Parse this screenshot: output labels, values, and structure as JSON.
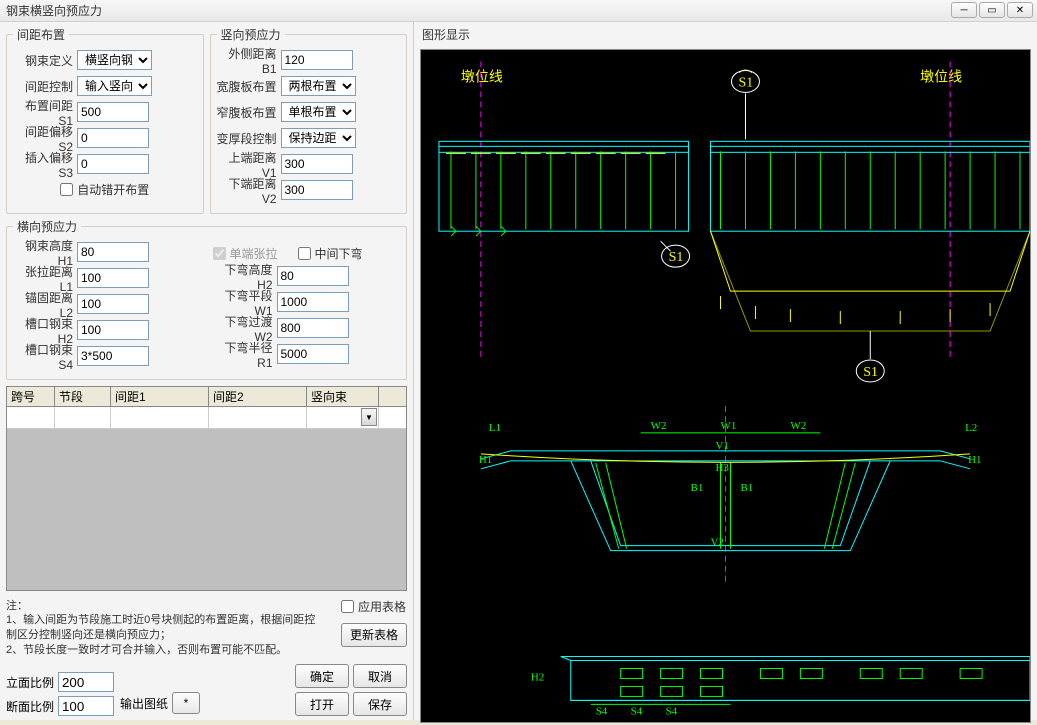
{
  "window": {
    "title": "钢束横竖向预应力"
  },
  "groups": {
    "spacing": "间距布置",
    "vertical": "竖向预应力",
    "lateral": "横向预应力"
  },
  "spacing": {
    "def_label": "钢束定义",
    "def_value": "横竖向钢",
    "ctrl_label": "间距控制",
    "ctrl_value": "输入竖向",
    "s1_label": "布置间距S1",
    "s1_value": "500",
    "s2_label": "间距偏移S2",
    "s2_value": "0",
    "s3_label": "插入偏移S3",
    "s3_value": "0",
    "auto_label": "自动错开布置"
  },
  "vertical": {
    "b1_label": "外侧距离B1",
    "b1_value": "120",
    "wide_label": "宽腹板布置",
    "wide_value": "两根布置",
    "narrow_label": "窄腹板布置",
    "narrow_value": "单根布置",
    "thick_label": "变厚段控制",
    "thick_value": "保持边距",
    "v1_label": "上端距离V1",
    "v1_value": "300",
    "v2_label": "下端距离V2",
    "v2_value": "300"
  },
  "lateral": {
    "h1_label": "钢束高度H1",
    "h1_value": "80",
    "l1_label": "张拉距离L1",
    "l1_value": "100",
    "l2_label": "锚固距离L2",
    "l2_value": "100",
    "h2_label": "槽口钢束H2",
    "h2_value": "100",
    "s4_label": "槽口钢束S4",
    "s4_value": "3*500",
    "single_label": "单端张拉",
    "mid_label": "中间下弯",
    "bh2_label": "下弯高度H2",
    "bh2_value": "80",
    "bw1_label": "下弯平段W1",
    "bw1_value": "1000",
    "bw2_label": "下弯过渡W2",
    "bw2_value": "800",
    "br1_label": "下弯半径R1",
    "br1_value": "5000"
  },
  "table": {
    "col1": "跨号",
    "col2": "节段",
    "col3": "间距1",
    "col4": "间距2",
    "col5": "竖向束"
  },
  "notes": {
    "header": "注：",
    "n1": "1、输入间距为节段施工时近0号块侧起的布置距离，根据间距控制区分控制竖向还是横向预应力；",
    "n2": "2、节段长度一致时才可合并输入，否则布置可能不匹配。"
  },
  "bottom": {
    "elev_label": "立面比例",
    "elev_value": "200",
    "sect_label": "断面比例",
    "sect_value": "100",
    "out_label": "输出图纸",
    "out_btn": "*",
    "apply": "应用表格",
    "refresh": "更新表格",
    "ok": "确定",
    "cancel": "取消",
    "open": "打开",
    "save": "保存"
  },
  "right": {
    "header": "图形显示"
  },
  "canvas": {
    "dunwei": "墩位线",
    "s1": "S1",
    "L1": "L1",
    "L2": "L2",
    "W1": "W1",
    "W2": "W2",
    "B1": "B1",
    "H1": "H1",
    "H3": "H3",
    "V1": "V1",
    "V2": "V2",
    "H2": "H2",
    "S4": "S4"
  }
}
